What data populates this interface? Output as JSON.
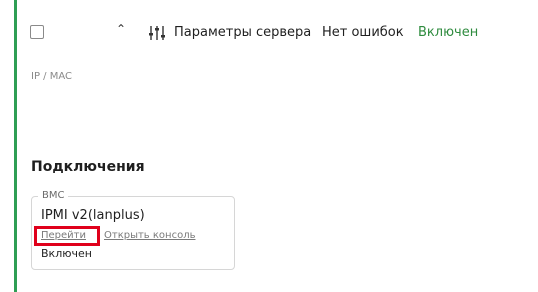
{
  "header": {
    "parameters_label": "Параметры сервера",
    "errors_label": "Нет ошибок",
    "status_label": "Включен",
    "icons": [
      "checkbox",
      "chevron-up-icon",
      "sliders-icon"
    ],
    "status_color": "#2e8b3e",
    "accent_color": "#2e9e54"
  },
  "ip_mac_label": "IP / MAC",
  "connections": {
    "title": "Подключения",
    "card": {
      "legend": "BMC",
      "protocol": "IPMI v2(lanplus)",
      "go_link": "Перейти",
      "console_link": "Открыть консоль",
      "status": "Включен"
    }
  },
  "highlight_color": "#e0001b"
}
